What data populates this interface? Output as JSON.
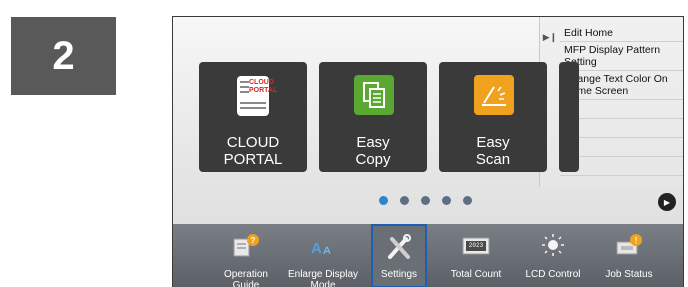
{
  "step": {
    "number": "2"
  },
  "side_menu": {
    "items": [
      {
        "label": "Edit Home"
      },
      {
        "label": "MFP Display Pattern Setting"
      },
      {
        "label": "Change Text Color On Home Screen"
      },
      {
        "label": ""
      },
      {
        "label": ""
      },
      {
        "label": ""
      },
      {
        "label": ""
      }
    ]
  },
  "tiles": [
    {
      "label": "CLOUD PORTAL",
      "icon": "cloud-portal-icon",
      "icon_text_line1": "CLOUD",
      "icon_text_line2": "PORTAL"
    },
    {
      "label": "Easy Copy",
      "icon": "copy-icon"
    },
    {
      "label": "Easy Scan",
      "icon": "scan-icon"
    }
  ],
  "pagination": {
    "pages": 5,
    "current_page": 1
  },
  "bottom_bar": {
    "items": [
      {
        "label": "Operation Guide",
        "icon": "operation-guide-icon"
      },
      {
        "label": "Enlarge Display Mode",
        "icon": "enlarge-display-icon"
      },
      {
        "label": "Settings",
        "icon": "settings-icon",
        "selected": true
      },
      {
        "label": "Total Count",
        "icon": "total-count-icon",
        "counter_text": "2023"
      },
      {
        "label": "LCD Control",
        "icon": "lcd-control-icon"
      },
      {
        "label": "Job Status",
        "icon": "job-status-icon"
      }
    ]
  },
  "colors": {
    "step_badge": "#595959",
    "tile_bg": "#3a3a3a",
    "copy_icon": "#5aa832",
    "scan_icon": "#f0a21e",
    "active_dot": "#2a86cf",
    "selected_outline": "#1c5fb5"
  }
}
